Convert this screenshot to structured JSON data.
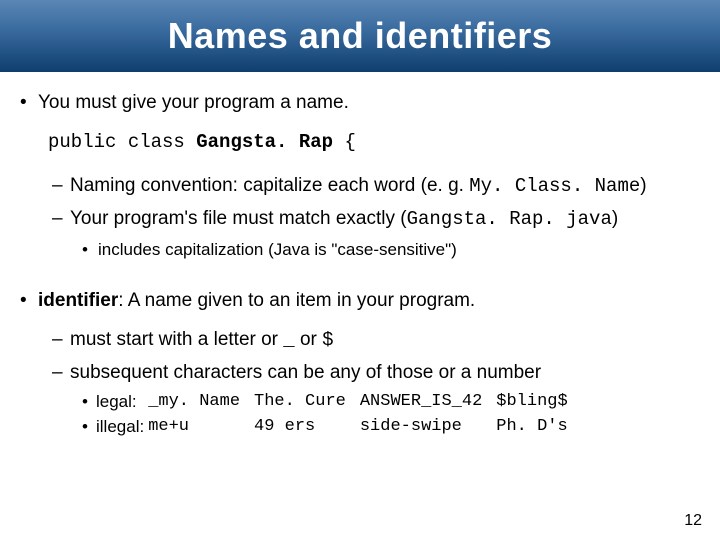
{
  "title": "Names and identifiers",
  "bullet1": "You must give your program a name.",
  "code": {
    "prefix": "public class ",
    "name": "Gangsta. Rap",
    "suffix": " {"
  },
  "sub1a_label": "Naming convention: capitalize each word (e. g. ",
  "sub1a_code": "My. Class. Name",
  "sub1a_close": ")",
  "sub1b_label": "Your program's file must match exactly (",
  "sub1b_code": "Gangsta. Rap. java",
  "sub1b_close": ")",
  "sub1b_sub": "includes capitalization (Java is \"case-sensitive\")",
  "bullet2_term": "identifier",
  "bullet2_rest": ": A name given to an item in your program.",
  "sub2a_text": "must start with a letter or ",
  "sub2a_code1": "_",
  "sub2a_mid": " or ",
  "sub2a_code2": "$",
  "sub2b": "subsequent characters can be any of those or a number",
  "examples": {
    "legal_label": "legal:",
    "illegal_label": "illegal:",
    "legal": [
      "_my. Name",
      "The. Cure",
      "ANSWER_IS_42",
      "$bling$"
    ],
    "illegal": [
      "me+u",
      "49 ers",
      "side-swipe",
      "Ph. D's"
    ]
  },
  "page": "12"
}
